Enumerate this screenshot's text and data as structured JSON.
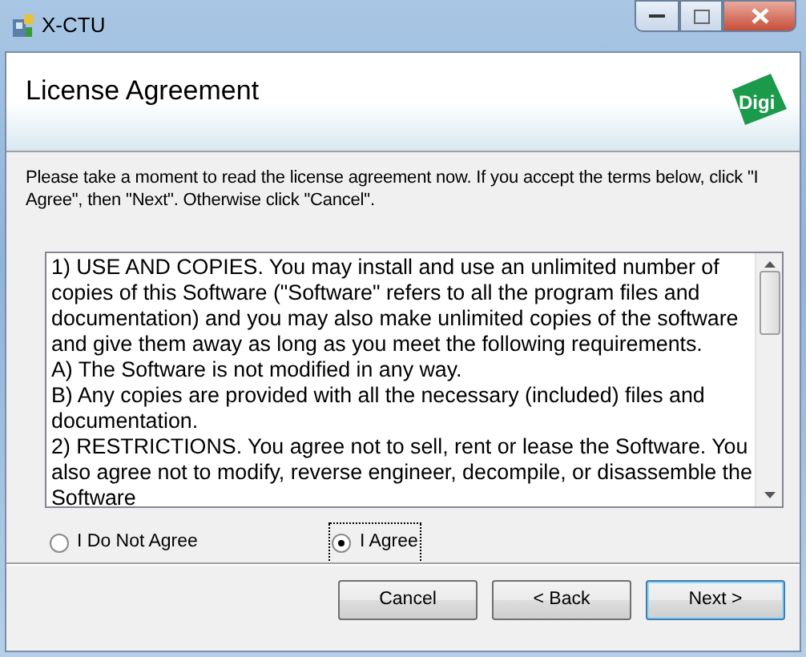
{
  "window": {
    "title": "X-CTU"
  },
  "header": {
    "title": "License Agreement",
    "logo_text": "Digi"
  },
  "instructions": "Please take a moment to read the license agreement now. If you accept the terms below, click \"I Agree\", then \"Next\". Otherwise click \"Cancel\".",
  "license_lines": [
    "1) USE AND COPIES. You may install and use an unlimited number of",
    "copies of this Software (\"Software\" refers to all the program files and",
    "documentation) and you may also make unlimited copies of the software",
    "and give them away as long as you meet the following requirements.",
    "A) The Software is not modified in any way.",
    "B) Any copies are provided with all the necessary (included) files and",
    "documentation.",
    "2) RESTRICTIONS. You agree not to sell, rent or lease the Software.  You",
    "also agree not to modify, reverse engineer, decompile, or disassemble the",
    "Software"
  ],
  "options": [
    {
      "label": "I Do Not Agree",
      "selected": false
    },
    {
      "label": "I Agree",
      "selected": true
    }
  ],
  "buttons": [
    {
      "label": "Cancel",
      "kind": "normal"
    },
    {
      "label": "< Back",
      "kind": "normal"
    },
    {
      "label": "Next >",
      "kind": "default"
    }
  ]
}
